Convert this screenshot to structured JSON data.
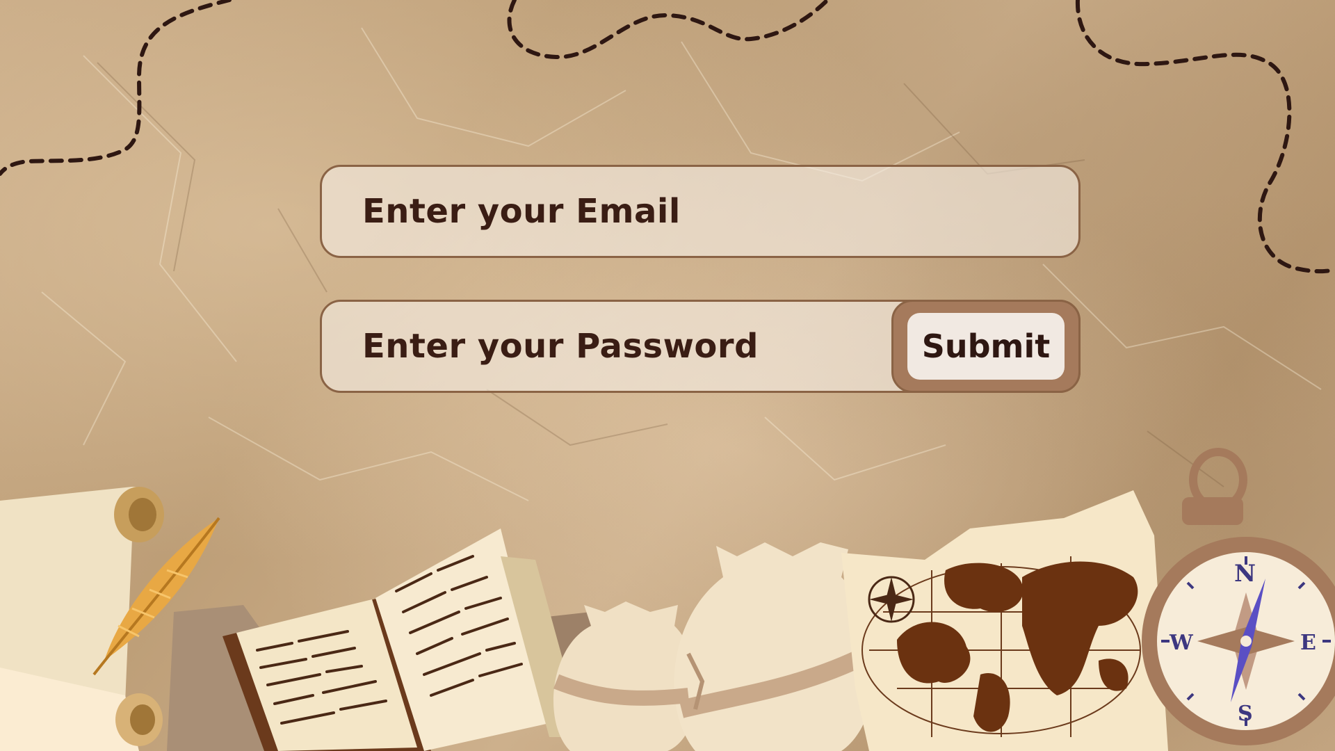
{
  "form": {
    "email_placeholder": "Enter your Email",
    "password_placeholder": "Enter your Password",
    "submit_label": "Submit"
  },
  "compass": {
    "north": "N",
    "east": "E",
    "south": "S",
    "west": "W"
  },
  "colors": {
    "paper": "#c4a681",
    "field_border": "#8a6345",
    "text": "#3a1d14",
    "submit_frame": "#a57a5c",
    "map_land": "#6b3210",
    "compass_needle": "#5a4fc4"
  }
}
